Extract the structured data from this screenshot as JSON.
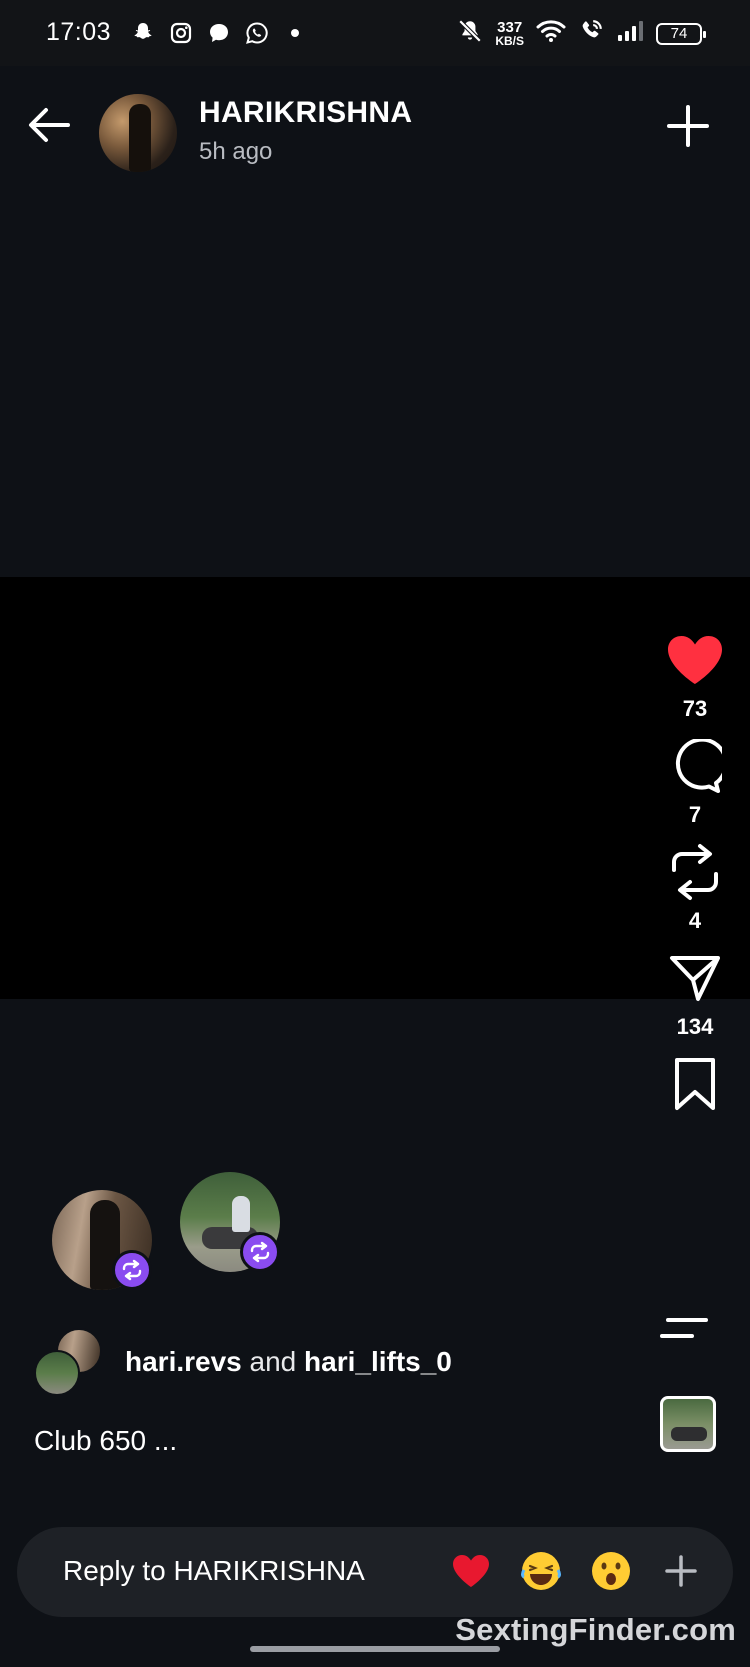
{
  "status_bar": {
    "time": "17:03",
    "icons_left": [
      "snapchat-icon",
      "instagram-icon",
      "chat-bubble-icon",
      "whatsapp-icon",
      "dot-icon"
    ],
    "net_speed_value": "337",
    "net_speed_unit": "KB/S",
    "battery": "74"
  },
  "header": {
    "username": "HARIKRISHNA",
    "time_ago": "5h ago"
  },
  "actions": {
    "likes": "73",
    "comments": "7",
    "reposts": "4",
    "shares": "134"
  },
  "reposted_by": {
    "user1": "hari.revs",
    "conjunction": "and",
    "user2": "hari_lifts_0"
  },
  "caption": "Club 650 ...",
  "reply": {
    "placeholder": "Reply to HARIKRISHNA",
    "reactions": [
      "❤️",
      "😂",
      "😮"
    ]
  },
  "watermark": "SextingFinder.com",
  "colors": {
    "background": "#0e1116",
    "media_background": "#000000",
    "like_red": "#ff3040",
    "repost_badge_purple": "#8a4cf0",
    "reply_bar": "#1e2126"
  }
}
